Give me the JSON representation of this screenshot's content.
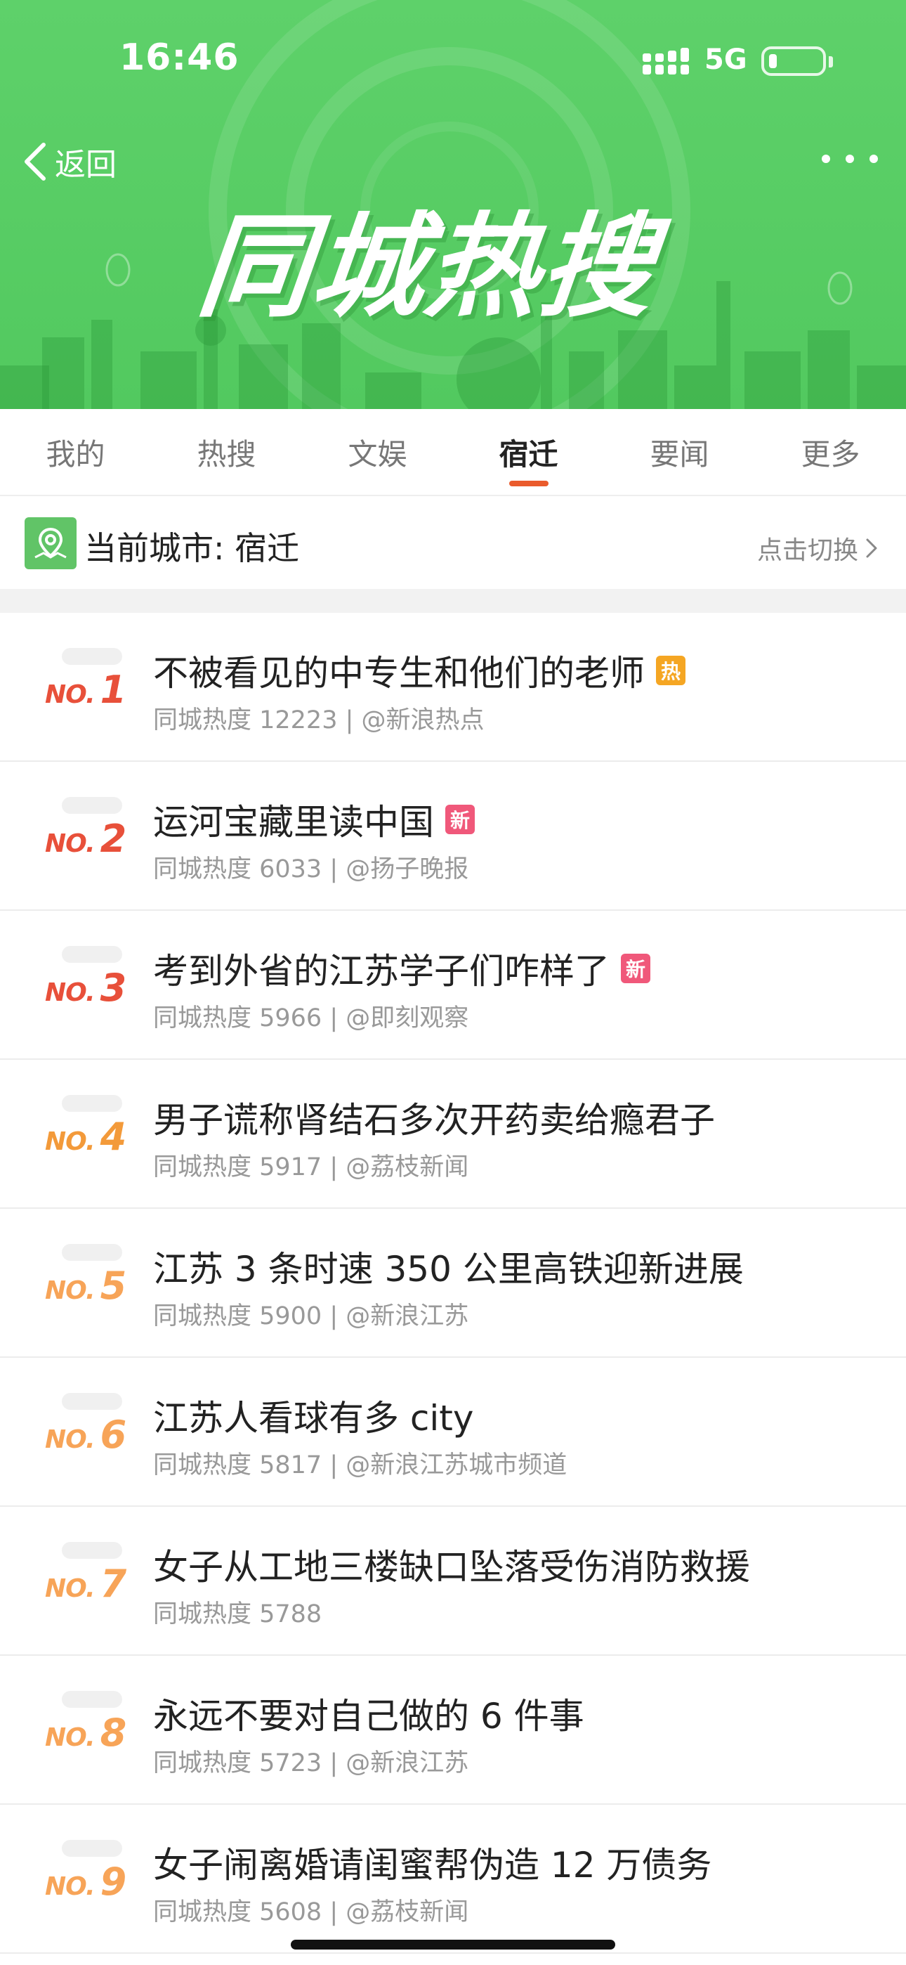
{
  "status_bar": {
    "time": "16:46",
    "network": "5G",
    "battery_level": 0.15
  },
  "header": {
    "back_label": "返回",
    "title": "同城热搜",
    "background_color": "#52c95f"
  },
  "tabs": [
    {
      "label": "我的",
      "active": false
    },
    {
      "label": "热搜",
      "active": false
    },
    {
      "label": "文娱",
      "active": false
    },
    {
      "label": "宿迁",
      "active": true
    },
    {
      "label": "要闻",
      "active": false
    },
    {
      "label": "更多",
      "active": false
    }
  ],
  "city": {
    "label": "当前城市: 宿迁",
    "switch_label": "点击切换"
  },
  "badge_colors": {
    "热": "#f5a623",
    "新": "#f0587a"
  },
  "rank_colors": [
    "#e8503a",
    "#e8503a",
    "#e8503a",
    "#f39a3a",
    "#f7a458",
    "#f7a458",
    "#f7a458",
    "#f7a458",
    "#f7a458"
  ],
  "items": [
    {
      "rank_prefix": "NO.",
      "rank": "1",
      "title": "不被看见的中专生和他们的老师",
      "badge": "热",
      "meta": "同城热度 12223 | @新浪热点"
    },
    {
      "rank_prefix": "NO.",
      "rank": "2",
      "title": "运河宝藏里读中国",
      "badge": "新",
      "meta": "同城热度 6033 | @扬子晚报"
    },
    {
      "rank_prefix": "NO.",
      "rank": "3",
      "title": "考到外省的江苏学子们咋样了",
      "badge": "新",
      "meta": "同城热度 5966 | @即刻观察"
    },
    {
      "rank_prefix": "NO.",
      "rank": "4",
      "title": "男子谎称肾结石多次开药卖给瘾君子",
      "badge": "",
      "meta": "同城热度 5917 | @荔枝新闻"
    },
    {
      "rank_prefix": "NO.",
      "rank": "5",
      "title": "江苏 3 条时速 350 公里高铁迎新进展",
      "badge": "",
      "meta": "同城热度 5900 | @新浪江苏"
    },
    {
      "rank_prefix": "NO.",
      "rank": "6",
      "title": "江苏人看球有多 city",
      "badge": "",
      "meta": "同城热度 5817 | @新浪江苏城市频道"
    },
    {
      "rank_prefix": "NO.",
      "rank": "7",
      "title": "女子从工地三楼缺口坠落受伤消防救援",
      "badge": "",
      "meta": "同城热度 5788"
    },
    {
      "rank_prefix": "NO.",
      "rank": "8",
      "title": "永远不要对自己做的 6 件事",
      "badge": "",
      "meta": "同城热度 5723 | @新浪江苏"
    },
    {
      "rank_prefix": "NO.",
      "rank": "9",
      "title": "女子闹离婚请闺蜜帮伪造 12 万债务",
      "badge": "",
      "meta": "同城热度 5608 | @荔枝新闻"
    }
  ]
}
